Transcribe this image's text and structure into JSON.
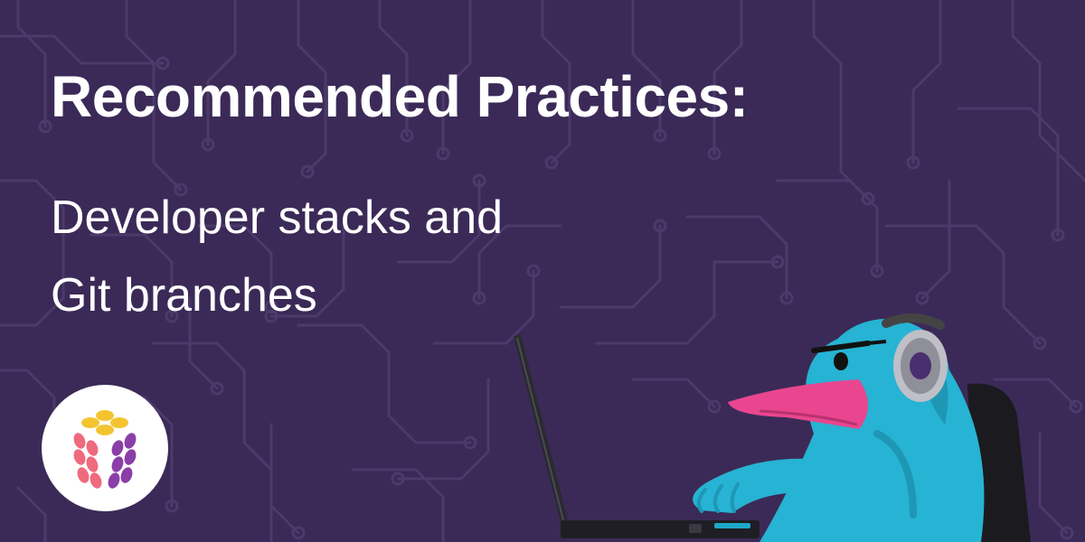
{
  "headline": "Recommended Practices:",
  "subtitle": {
    "line1": "Developer stacks and",
    "line2": "Git branches"
  },
  "colors": {
    "background": "#3b2a57",
    "circuit": "#4b3a6a",
    "text": "#ffffff",
    "logo_yellow": "#f4c430",
    "logo_pink": "#ef6a7d",
    "logo_purple": "#8a3ea8",
    "mascot_body": "#27b3d3",
    "mascot_beak": "#e9468f",
    "headphones": "#bfbfc7"
  },
  "icons": {
    "logo": "platform-logo-icon",
    "mascot": "duck-mascot-illustration"
  }
}
